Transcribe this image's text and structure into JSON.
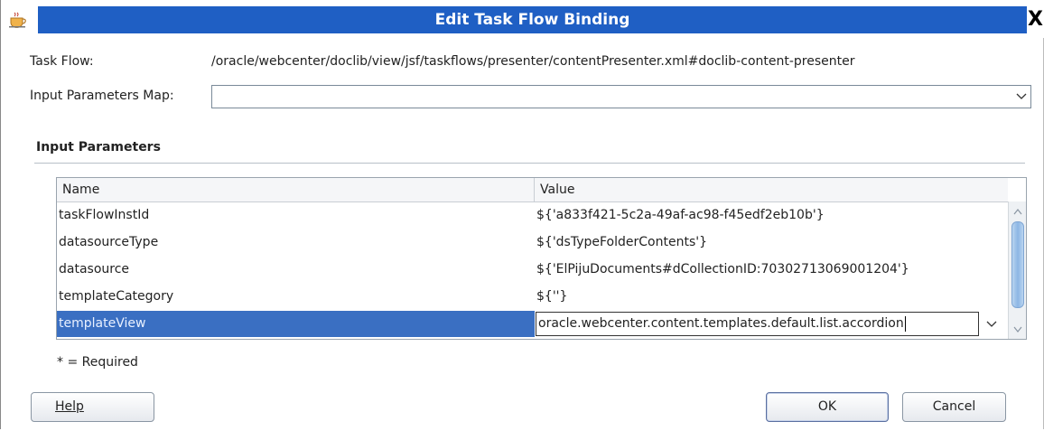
{
  "window": {
    "title": "Edit Task Flow Binding",
    "close_glyph": "X",
    "icon": "java-cup-icon"
  },
  "task_flow": {
    "label": "Task Flow:",
    "value": "/oracle/webcenter/doclib/view/jsf/taskflows/presenter/contentPresenter.xml#doclib-content-presenter"
  },
  "params_map": {
    "label": "Input Parameters Map:",
    "value": ""
  },
  "section": {
    "title": "Input Parameters"
  },
  "table": {
    "headers": {
      "name": "Name",
      "value": "Value"
    },
    "rows": [
      {
        "name": "taskFlowInstId",
        "value": "${'a833f421-5c2a-49af-ac98-f45edf2eb10b'}"
      },
      {
        "name": "datasourceType",
        "value": "${'dsTypeFolderContents'}"
      },
      {
        "name": "datasource",
        "value": "${'ElPijuDocuments#dCollectionID:703027130690012​04'}"
      },
      {
        "name": "templateCategory",
        "value": "${''}"
      },
      {
        "name": "templateView",
        "value": "oracle.webcenter.content.templates.default.list.accordion"
      }
    ],
    "selected_row": 4
  },
  "required_note": "* = Required",
  "buttons": {
    "help": "Help",
    "ok": "OK",
    "cancel": "Cancel"
  },
  "colors": {
    "title_bar": "#1f5fc4",
    "selection": "#3a6fc2"
  }
}
